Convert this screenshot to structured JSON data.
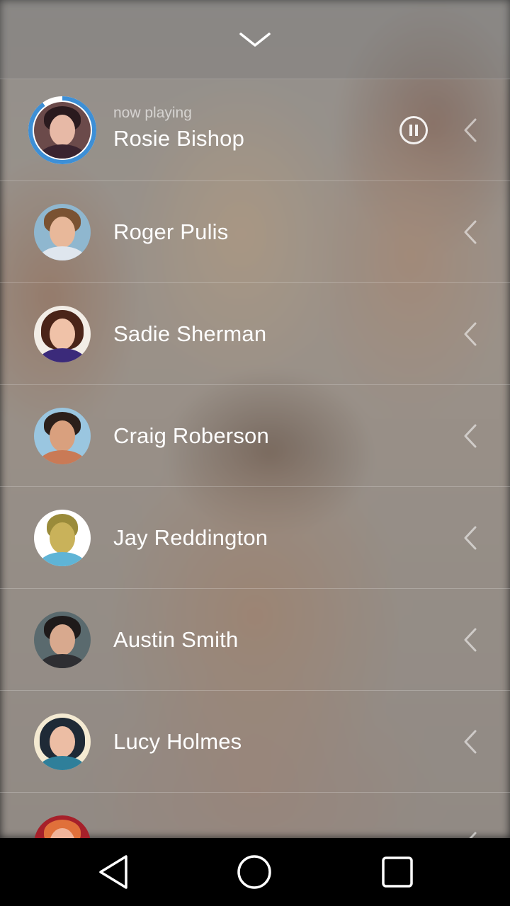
{
  "now_playing_label": "now playing",
  "contacts": [
    {
      "name": "Rosie Bishop"
    },
    {
      "name": "Roger Pulis"
    },
    {
      "name": "Sadie Sherman"
    },
    {
      "name": "Craig Roberson"
    },
    {
      "name": "Jay Reddington"
    },
    {
      "name": "Austin Smith"
    },
    {
      "name": "Lucy Holmes"
    }
  ],
  "playback_progress": 0.9,
  "colors": {
    "progress_accent": "#3d8fd6",
    "text": "#ffffff",
    "navbar": "#000000"
  },
  "icons": {
    "collapse": "chevron-down-icon",
    "pause": "pause-icon",
    "row_action": "chevron-left-icon",
    "nav_back": "back-triangle-icon",
    "nav_home": "home-circle-icon",
    "nav_recents": "recents-square-icon"
  }
}
